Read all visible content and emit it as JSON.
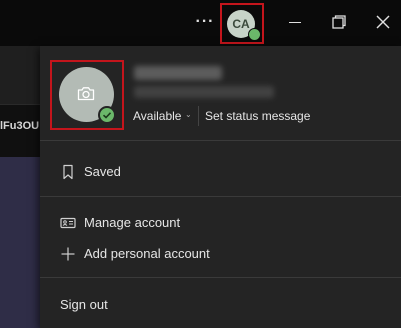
{
  "titlebar": {
    "more_icon": "ellipsis",
    "avatar_initials": "CA",
    "status_color": "#6bb86a",
    "minimize_icon": "minimize",
    "maximize_icon": "restore",
    "close_icon": "close"
  },
  "background": {
    "channel_text": "lFu3OU"
  },
  "profile": {
    "status_label": "Available",
    "set_status_label": "Set status message"
  },
  "menu": {
    "saved": "Saved",
    "manage_account": "Manage account",
    "add_personal_account": "Add personal account",
    "sign_out": "Sign out"
  },
  "colors": {
    "highlight_frame": "#c4151c",
    "panel_bg": "#242424",
    "presence_available": "#6bb86a"
  }
}
